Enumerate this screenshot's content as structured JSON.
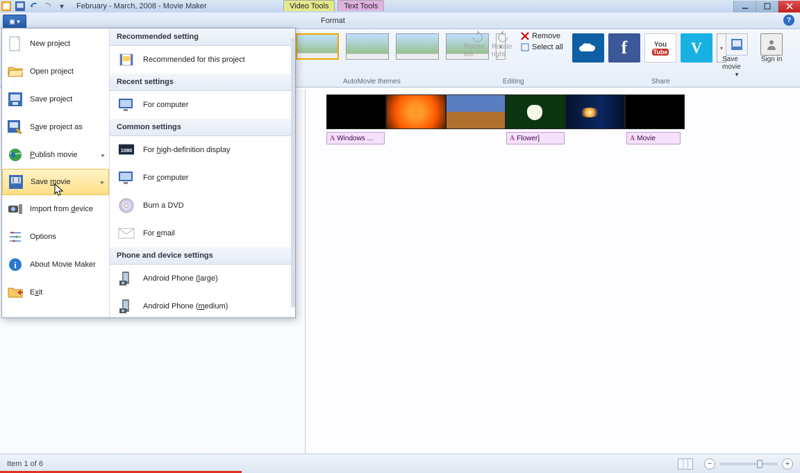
{
  "title": "February - March, 2008 - Movie Maker",
  "contextual_tabs": {
    "video": "Video Tools",
    "text": "Text Tools"
  },
  "tabs": {
    "format": "Format"
  },
  "ribbon": {
    "themes_label": "AutoMovie themes",
    "editing_label": "Editing",
    "share_label": "Share",
    "rotate_left": "Rotate left",
    "rotate_right": "Rotate right",
    "remove": "Remove",
    "select_all": "Select all",
    "save_movie": "Save movie",
    "sign_in": "Sign in"
  },
  "file_menu": {
    "items": [
      {
        "label": "New project",
        "id": "new-project"
      },
      {
        "label": "Open project",
        "id": "open-project"
      },
      {
        "label": "Save project",
        "id": "save-project"
      },
      {
        "label": "Save project as",
        "id": "save-project-as",
        "underline": "a"
      },
      {
        "label": "Publish movie",
        "id": "publish-movie",
        "underline": "P",
        "arrow": true
      },
      {
        "label": "Save movie",
        "id": "save-movie",
        "underline": "m",
        "arrow": true,
        "hover": true
      },
      {
        "label": "Import from device",
        "id": "import-device",
        "underline": "d"
      },
      {
        "label": "Options",
        "id": "options"
      },
      {
        "label": "About Movie Maker",
        "id": "about"
      },
      {
        "label": "Exit",
        "id": "exit",
        "underline": "x"
      }
    ],
    "submenu": {
      "sections": [
        {
          "header": "Recommended setting",
          "options": [
            {
              "label": "Recommended for this project",
              "icon": "film"
            }
          ]
        },
        {
          "header": "Recent settings",
          "options": [
            {
              "label": "For computer",
              "icon": "monitor"
            }
          ]
        },
        {
          "header": "Common settings",
          "options": [
            {
              "label": "For high-definition display",
              "underline": "h",
              "icon": "hd"
            },
            {
              "label": "For computer",
              "underline": "c",
              "icon": "monitor"
            },
            {
              "label": "Burn a DVD",
              "icon": "dvd"
            },
            {
              "label": "For email",
              "underline": "e",
              "icon": "email"
            }
          ]
        },
        {
          "header": "Phone and device settings",
          "options": [
            {
              "label": "Android Phone (large)",
              "underline": "l",
              "icon": "phone"
            },
            {
              "label": "Android Phone (medium)",
              "underline": "m",
              "icon": "phone"
            }
          ]
        }
      ]
    }
  },
  "timeline": {
    "captions": [
      {
        "label": "Windows ..."
      },
      {
        "label": "Flower]"
      },
      {
        "label": "Movie"
      }
    ]
  },
  "status": {
    "text": "Item 1 of 6"
  }
}
